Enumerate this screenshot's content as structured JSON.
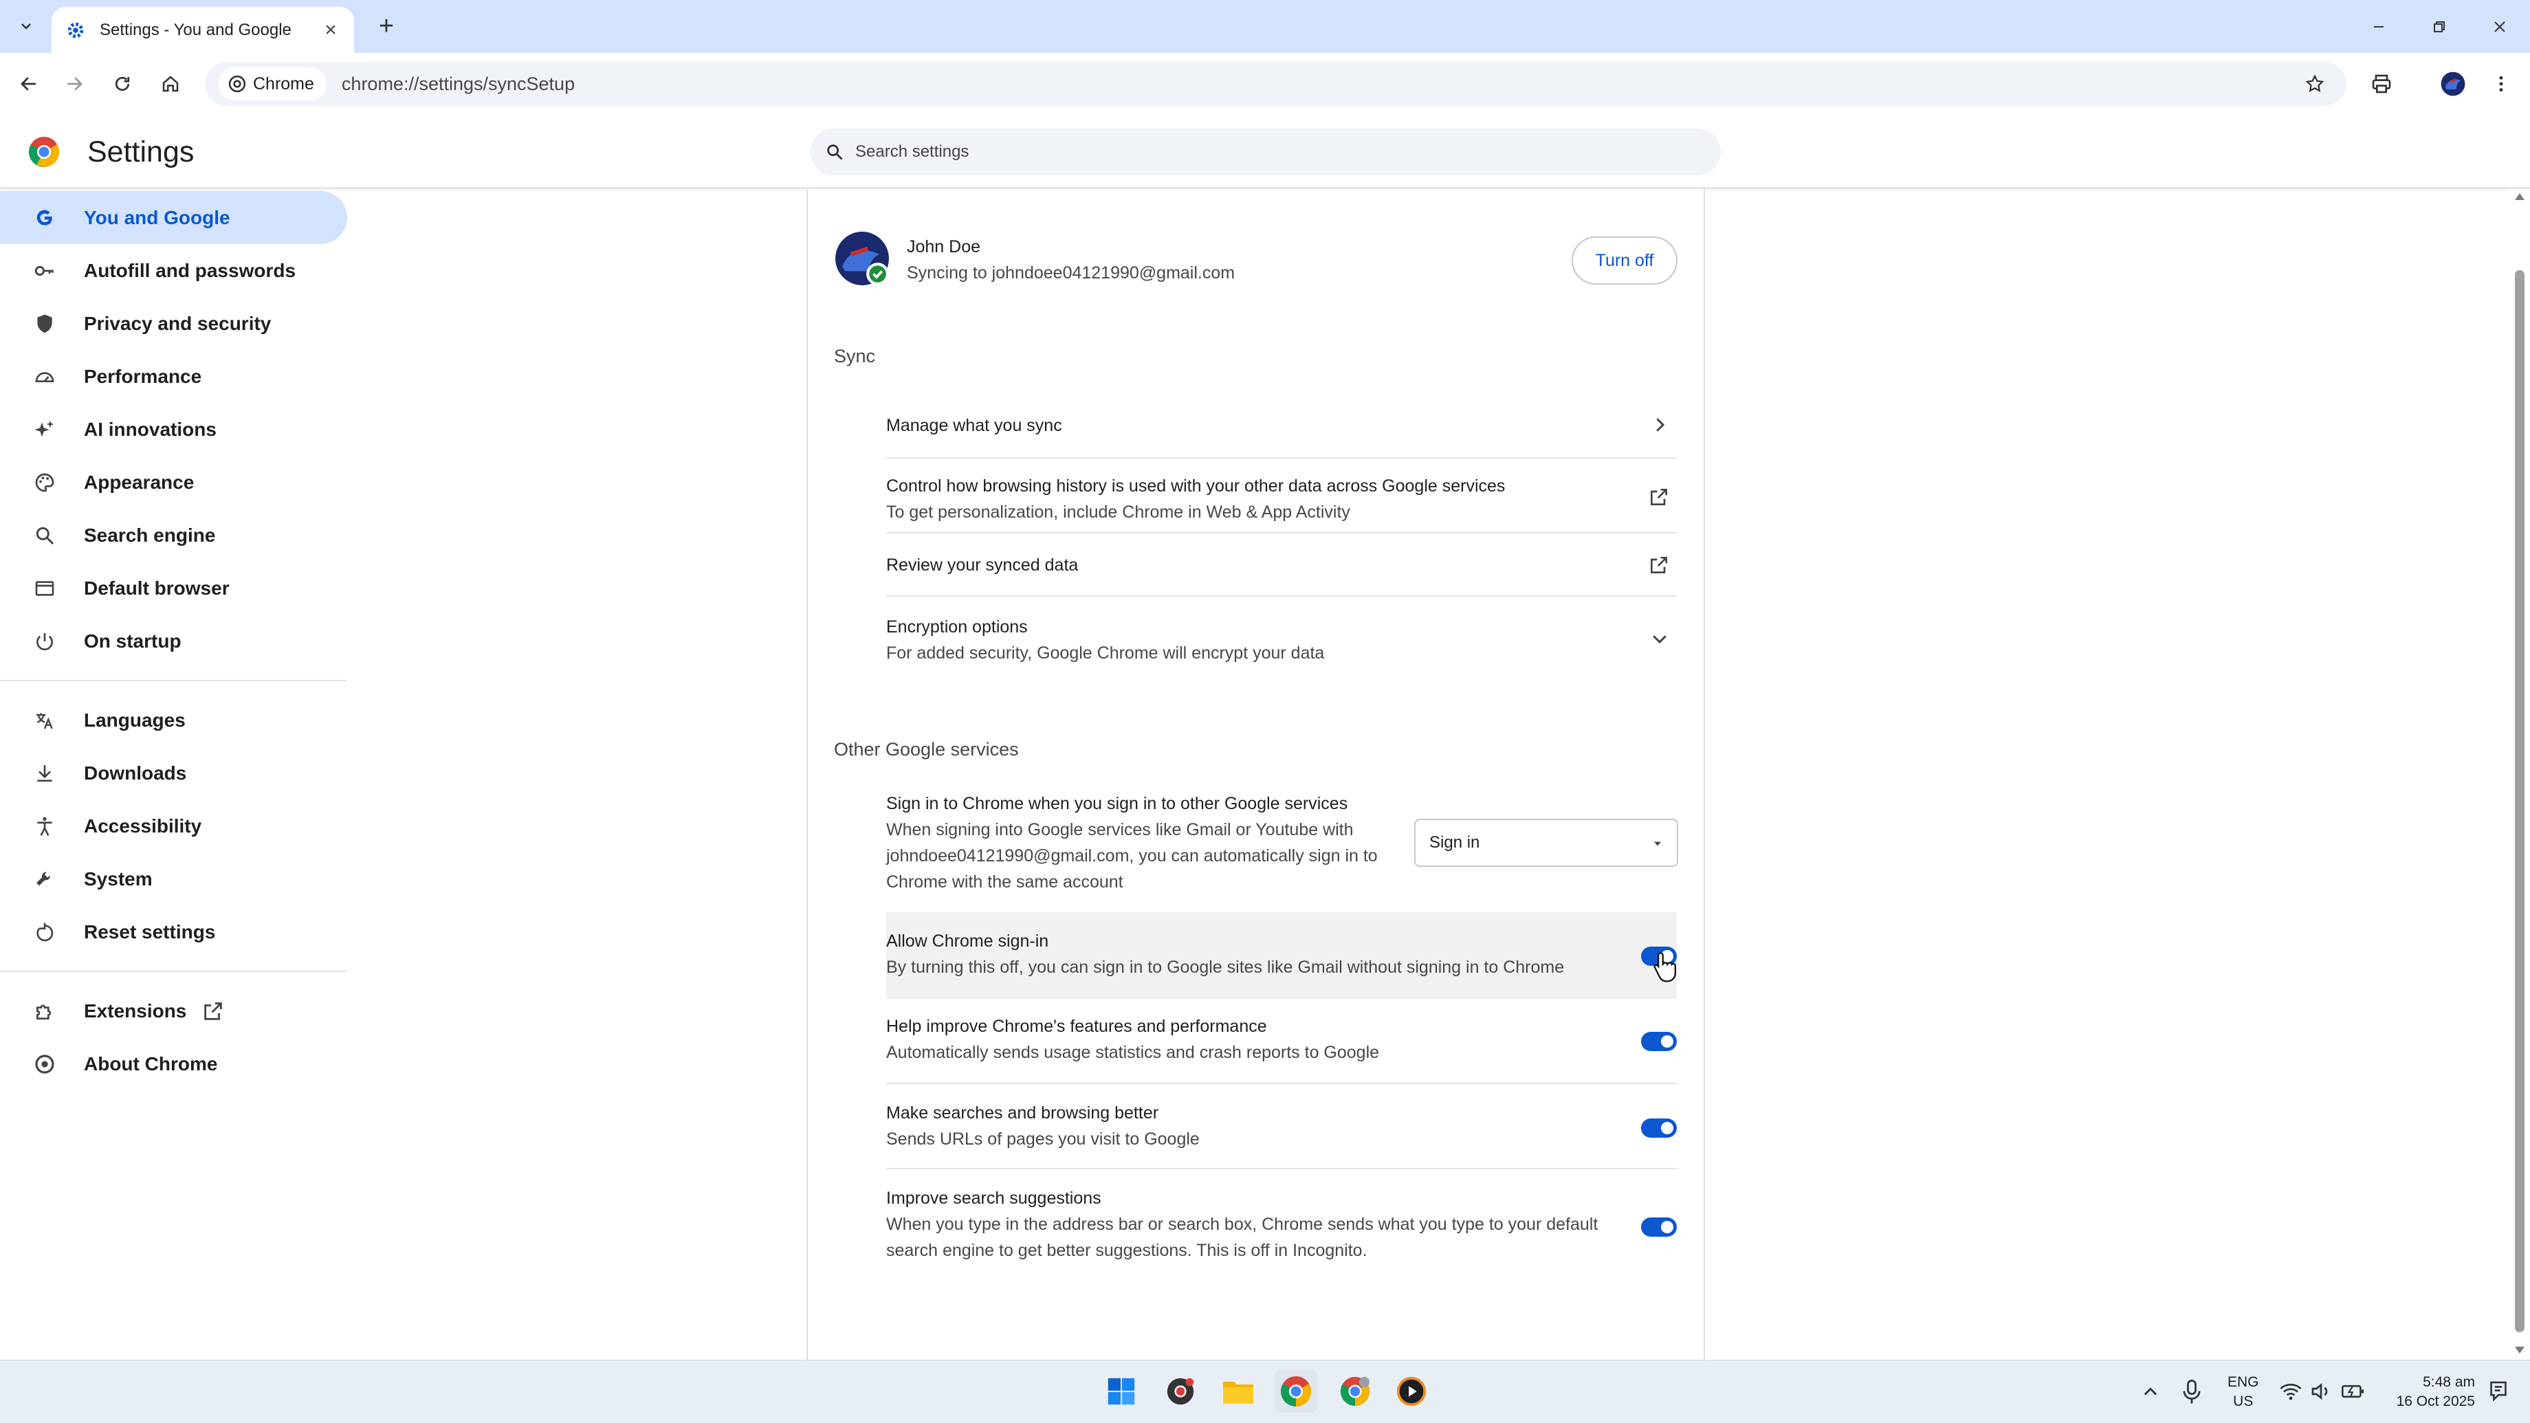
{
  "browser": {
    "tab_title": "Settings - You and Google",
    "chip_label": "Chrome",
    "url": "chrome://settings/syncSetup"
  },
  "header": {
    "title": "Settings",
    "search_placeholder": "Search settings"
  },
  "sidebar": {
    "items": [
      {
        "label": "You and Google",
        "icon": "google-g-icon"
      },
      {
        "label": "Autofill and passwords",
        "icon": "key-icon"
      },
      {
        "label": "Privacy and security",
        "icon": "shield-icon"
      },
      {
        "label": "Performance",
        "icon": "speedometer-icon"
      },
      {
        "label": "AI innovations",
        "icon": "sparkle-icon"
      },
      {
        "label": "Appearance",
        "icon": "palette-icon"
      },
      {
        "label": "Search engine",
        "icon": "search-icon"
      },
      {
        "label": "Default browser",
        "icon": "browser-window-icon"
      },
      {
        "label": "On startup",
        "icon": "power-icon"
      },
      {
        "label": "Languages",
        "icon": "translate-icon"
      },
      {
        "label": "Downloads",
        "icon": "download-icon"
      },
      {
        "label": "Accessibility",
        "icon": "accessibility-icon"
      },
      {
        "label": "System",
        "icon": "wrench-icon"
      },
      {
        "label": "Reset settings",
        "icon": "reset-icon"
      },
      {
        "label": "Extensions",
        "icon": "puzzle-icon"
      },
      {
        "label": "About Chrome",
        "icon": "chrome-icon"
      }
    ]
  },
  "account": {
    "name": "John Doe",
    "status": "Syncing to johndoee04121990@gmail.com",
    "turn_off_label": "Turn off"
  },
  "sync": {
    "heading": "Sync",
    "manage": "Manage what you sync",
    "control_title": "Control how browsing history is used with your other data across Google services",
    "control_sub": "To get personalization, include Chrome in Web & App Activity",
    "review": "Review your synced data",
    "encryption_title": "Encryption options",
    "encryption_sub": "For added security, Google Chrome will encrypt your data"
  },
  "other": {
    "heading": "Other Google services",
    "signin_title": "Sign in to Chrome when you sign in to other Google services",
    "signin_sub_1": "When signing into Google services like Gmail or Youtube with",
    "signin_sub_2": "johndoee04121990@gmail.com, you can automatically sign in to",
    "signin_sub_3": "Chrome with the same account",
    "signin_select": "Sign in",
    "allow_title": "Allow Chrome sign-in",
    "allow_sub": "By turning this off, you can sign in to Google sites like Gmail without signing in to Chrome",
    "allow_on": true,
    "help_title": "Help improve Chrome's features and performance",
    "help_sub": "Automatically sends usage statistics and crash reports to Google",
    "help_on": true,
    "make_title": "Make searches and browsing better",
    "make_sub": "Sends URLs of pages you visit to Google",
    "make_on": true,
    "improve_title": "Improve search suggestions",
    "improve_sub_1": "When you type in the address bar or search box, Chrome sends what you type to your default",
    "improve_sub_2": "search engine to get better suggestions. This is off in Incognito.",
    "improve_on": true
  },
  "taskbar": {
    "lang_1": "ENG",
    "lang_2": "US",
    "time": "5:48 am",
    "date": "16 Oct 2025"
  },
  "colors": {
    "accent": "#0b57d0",
    "tabstrip": "#d3e3fd",
    "active_nav_bg": "#d3e3fd"
  }
}
